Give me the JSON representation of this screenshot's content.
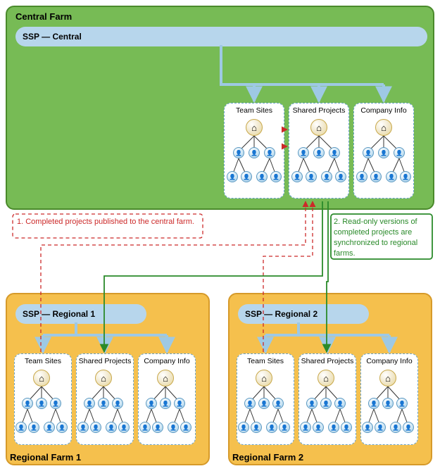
{
  "central_farm": {
    "title": "Central Farm",
    "ssp_label": "SSP — Central",
    "sites": [
      "Team Sites",
      "Shared Projects",
      "Company Info"
    ]
  },
  "regional_farm_1": {
    "title": "Regional Farm 1",
    "ssp_label": "SSP — Regional 1",
    "sites": [
      "Team Sites",
      "Shared Projects",
      "Company Info"
    ]
  },
  "regional_farm_2": {
    "title": "Regional Farm 2",
    "ssp_label": "SSP — Regional 2",
    "sites": [
      "Team Sites",
      "Shared Projects",
      "Company Info"
    ]
  },
  "annotations": {
    "publish": "1. Completed projects published to the central farm.",
    "sync": "2. Read-only versions of completed projects are synchronized to regional farms."
  },
  "icons": {
    "home": "⌂",
    "user": "👤"
  }
}
